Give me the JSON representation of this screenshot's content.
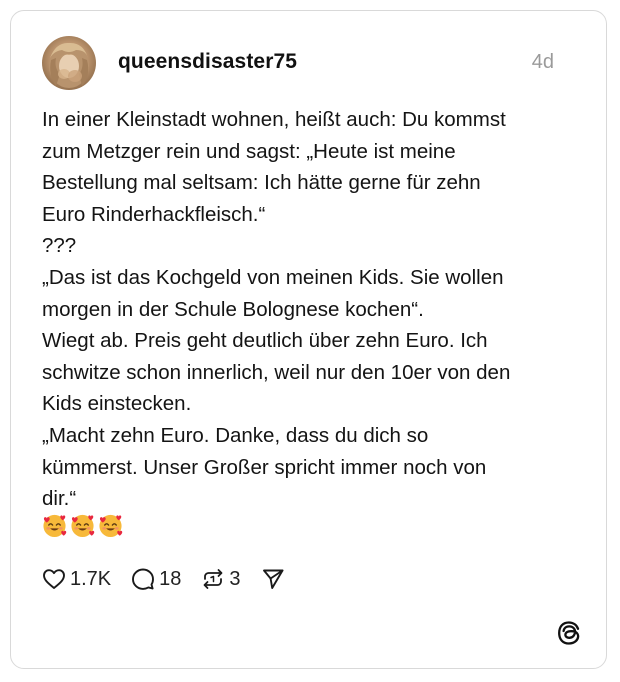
{
  "post": {
    "username": "queensdisaster75",
    "timestamp": "4d",
    "body_lines": [
      "In einer Kleinstadt wohnen, heißt auch: Du kommst",
      "zum Metzger rein und sagst: „Heute ist meine",
      "Bestellung mal seltsam: Ich hätte gerne für zehn",
      "Euro Rinderhackfleisch.“",
      "???",
      "„Das ist das Kochgeld von meinen Kids. Sie wollen",
      "morgen in der Schule Bolognese kochen“.",
      "Wiegt ab. Preis geht deutlich über zehn Euro. Ich",
      "schwitze schon innerlich, weil nur den 10er von den",
      "Kids einstecken.",
      "„Macht zehn Euro. Danke, dass du dich so",
      "kümmerst. Unser Großer spricht immer noch von",
      "dir.“"
    ],
    "emoji_count": 3,
    "emoji_name": "smiling-face-with-hearts"
  },
  "actions": {
    "likes": "1.7K",
    "replies": "18",
    "reposts": "3",
    "like_icon": "heart-icon",
    "reply_icon": "speech-bubble-icon",
    "repost_icon": "repost-icon",
    "share_icon": "send-icon"
  },
  "branding": {
    "logo_icon": "threads-logo-icon"
  },
  "colors": {
    "text": "#141414",
    "muted": "#9a9a9a",
    "border": "#d9d9d9"
  }
}
